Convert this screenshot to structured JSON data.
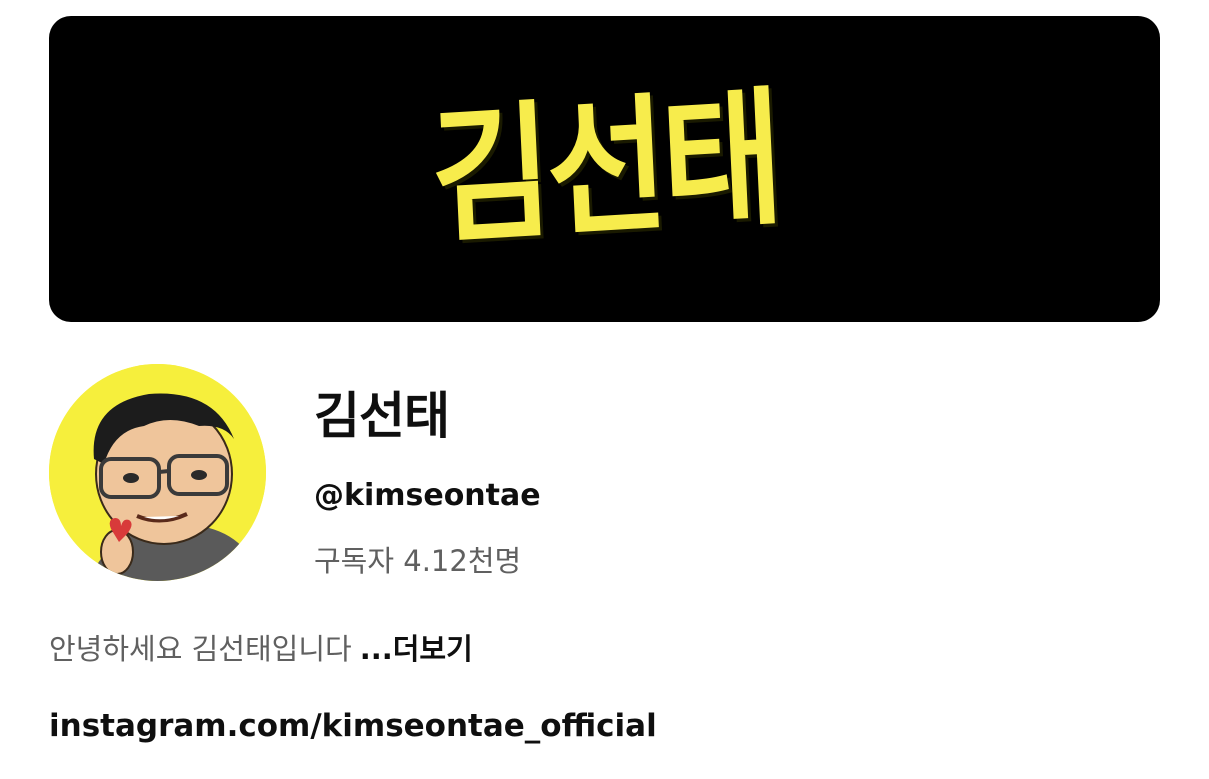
{
  "banner": {
    "logo_text": "김선태"
  },
  "channel": {
    "name": "김선태",
    "handle": "@kimseontae",
    "subscribers_label": "구독자",
    "subscribers_count": "4.12천명",
    "description": "안녕하세요 김선태입니다",
    "more_label": "...더보기",
    "link": "instagram.com/kimseontae_official"
  },
  "colors": {
    "banner_bg": "#000000",
    "logo_yellow": "#f7ec4c",
    "avatar_bg": "#f6ef3c",
    "secondary_text": "#606060"
  }
}
